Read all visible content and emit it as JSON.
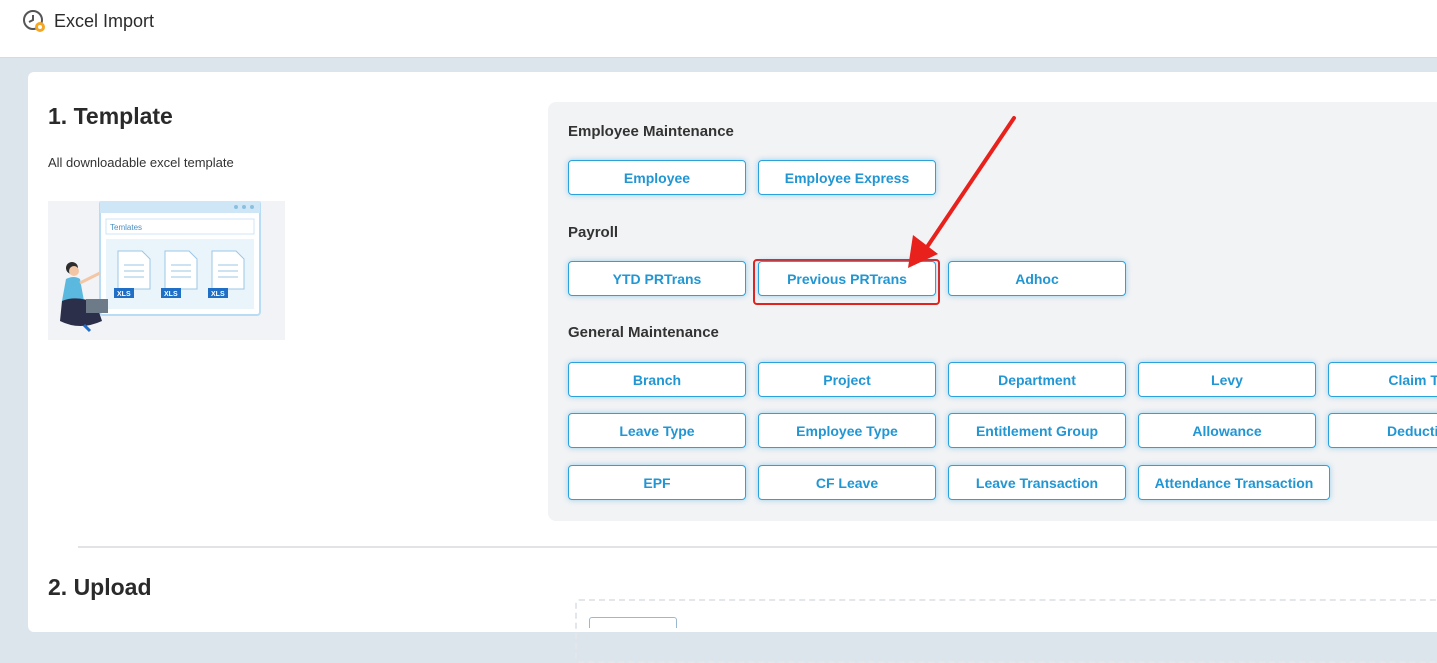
{
  "header": {
    "title": "Excel Import",
    "icon": "clock-gear-icon"
  },
  "template": {
    "heading": "1. Template",
    "description": "All downloadable excel template",
    "illustration": {
      "window_label": "Temlates",
      "file_badge": "XLS"
    }
  },
  "groups": {
    "employee_maintenance": {
      "label": "Employee Maintenance",
      "buttons": [
        "Employee",
        "Employee Express"
      ]
    },
    "payroll": {
      "label": "Payroll",
      "buttons": [
        "YTD PRTrans",
        "Previous PRTrans",
        "Adhoc"
      ]
    },
    "general_maintenance": {
      "label": "General Maintenance",
      "buttons": [
        "Branch",
        "Project",
        "Department",
        "Levy",
        "Claim Ty",
        "Leave Type",
        "Employee Type",
        "Entitlement Group",
        "Allowance",
        "Deductio",
        "EPF",
        "CF Leave",
        "Leave Transaction",
        "Attendance Transaction"
      ]
    }
  },
  "upload": {
    "heading": "2. Upload"
  },
  "colors": {
    "accent": "#2196d3",
    "highlight": "#e0231f",
    "panel": "#f2f3f5"
  }
}
